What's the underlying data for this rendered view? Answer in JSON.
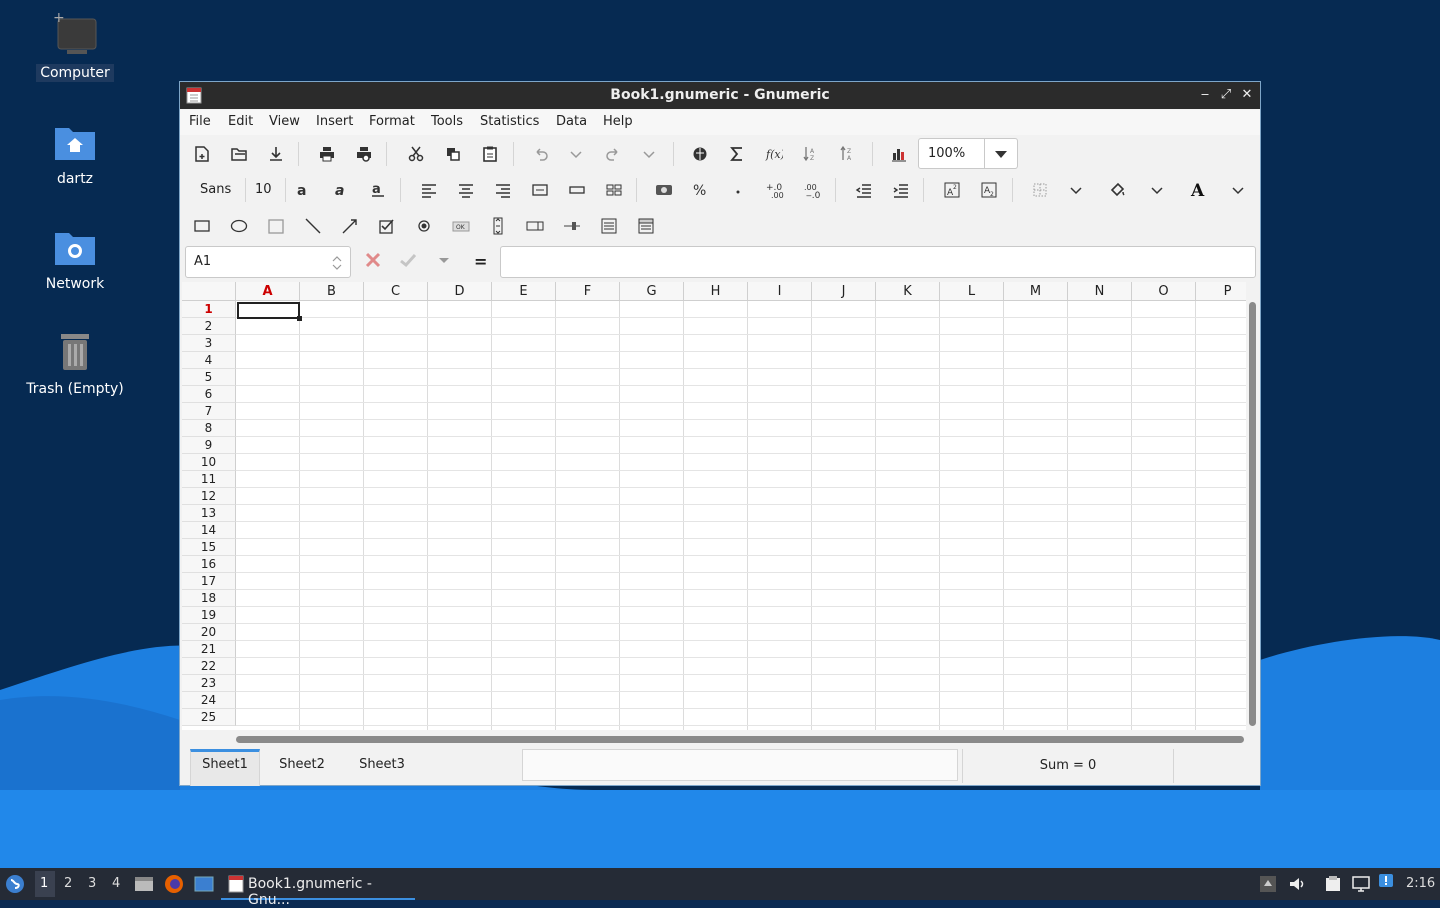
{
  "desktop": {
    "icons": [
      {
        "label": "Computer",
        "icon": "computer-icon"
      },
      {
        "label": "dartz",
        "icon": "home-folder-icon"
      },
      {
        "label": "Network",
        "icon": "network-folder-icon"
      },
      {
        "label": "Trash (Empty)",
        "icon": "trash-icon"
      }
    ]
  },
  "window": {
    "title": "Book1.gnumeric - Gnumeric",
    "controls": {
      "minimize": "‒",
      "maximize": "⤢",
      "close": "✕"
    }
  },
  "menubar": [
    "File",
    "Edit",
    "View",
    "Insert",
    "Format",
    "Tools",
    "Statistics",
    "Data",
    "Help"
  ],
  "toolbar_format": {
    "font_name": "Sans",
    "font_size": "10"
  },
  "zoom": {
    "value": "100%"
  },
  "formula_bar": {
    "cell_ref": "A1",
    "equals_label": "=",
    "content": ""
  },
  "grid": {
    "columns": [
      "A",
      "B",
      "C",
      "D",
      "E",
      "F",
      "G",
      "H",
      "I",
      "J",
      "K",
      "L",
      "M",
      "N",
      "O",
      "P"
    ],
    "rows": [
      "1",
      "2",
      "3",
      "4",
      "5",
      "6",
      "7",
      "8",
      "9",
      "10",
      "11",
      "12",
      "13",
      "14",
      "15",
      "16",
      "17",
      "18",
      "19",
      "20",
      "21",
      "22",
      "23",
      "24",
      "25"
    ],
    "active_cell": "A1"
  },
  "sheets": [
    "Sheet1",
    "Sheet2",
    "Sheet3"
  ],
  "active_sheet": "Sheet1",
  "status": {
    "sum": "Sum = 0"
  },
  "taskbar": {
    "workspaces": [
      "1",
      "2",
      "3",
      "4"
    ],
    "active_workspace": "1",
    "task_label": "Book1.gnumeric - Gnu...",
    "clock": "2:16"
  },
  "colors": {
    "accent": "#3b8fe0",
    "active_header": "#cc0000",
    "titlebar": "#2b2b2b"
  }
}
